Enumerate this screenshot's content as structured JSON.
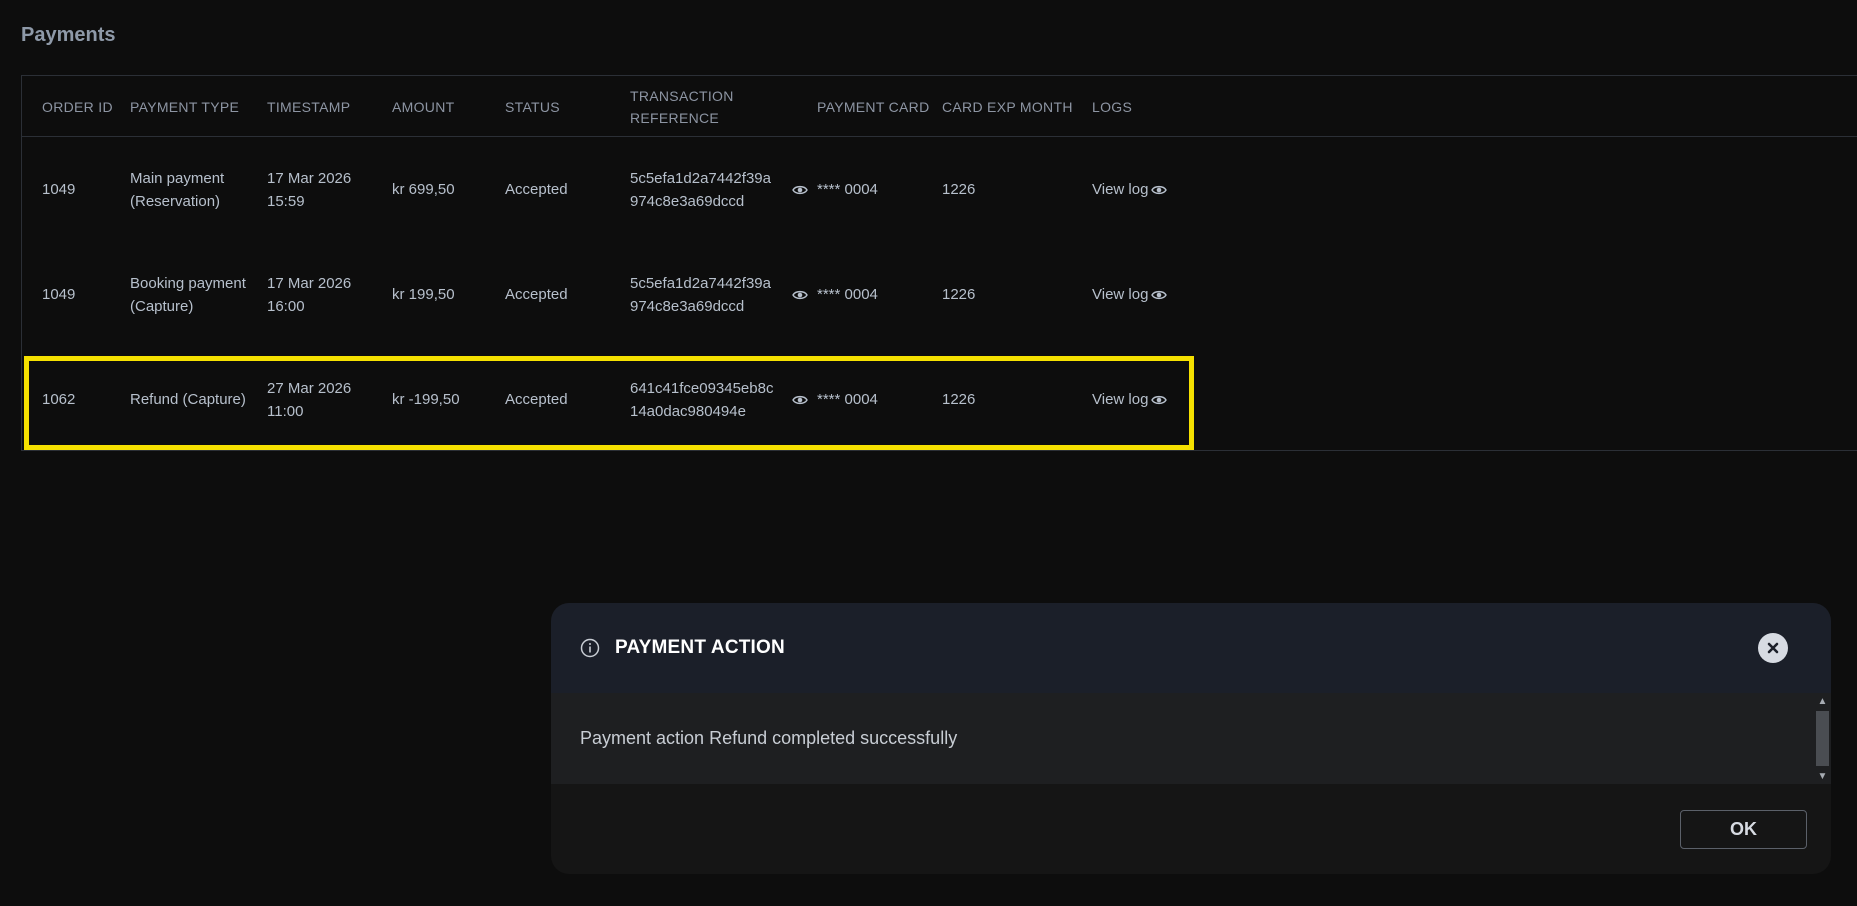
{
  "page_title": "Payments",
  "table": {
    "columns": [
      "ORDER ID",
      "PAYMENT TYPE",
      "TIMESTAMP",
      "AMOUNT",
      "STATUS",
      "TRANSACTION REFERENCE",
      "PAYMENT CARD",
      "CARD EXP MONTH",
      "LOGS"
    ],
    "rows": [
      {
        "order_id": "1049",
        "payment_type": [
          "Main payment",
          "(Reservation)"
        ],
        "timestamp": [
          "17 Mar 2026",
          "15:59"
        ],
        "amount": "kr 699,50",
        "status": "Accepted",
        "transaction_reference": [
          "5c5efa1d2a7442f39a",
          "974c8e3a69dccd"
        ],
        "payment_card": "**** 0004",
        "card_exp_month": "1226",
        "log": "View log"
      },
      {
        "order_id": "1049",
        "payment_type": [
          "Booking payment",
          "(Capture)"
        ],
        "timestamp": [
          "17 Mar 2026",
          "16:00"
        ],
        "amount": "kr 199,50",
        "status": "Accepted",
        "transaction_reference": [
          "5c5efa1d2a7442f39a",
          "974c8e3a69dccd"
        ],
        "payment_card": "**** 0004",
        "card_exp_month": "1226",
        "log": "View log"
      },
      {
        "order_id": "1062",
        "payment_type": [
          "Refund (Capture)"
        ],
        "timestamp": [
          "27 Mar 2026",
          "11:00"
        ],
        "amount": "kr -199,50",
        "status": "Accepted",
        "transaction_reference": [
          "641c41fce09345eb8c",
          "14a0dac980494e"
        ],
        "payment_card": "**** 0004",
        "card_exp_month": "1226",
        "log": "View log"
      }
    ]
  },
  "highlight_color": "#f5e000",
  "dialog": {
    "title": "PAYMENT ACTION",
    "message": "Payment action Refund completed successfully",
    "ok_label": "OK",
    "icons": {
      "info": "info-icon",
      "close": "close-icon"
    }
  }
}
